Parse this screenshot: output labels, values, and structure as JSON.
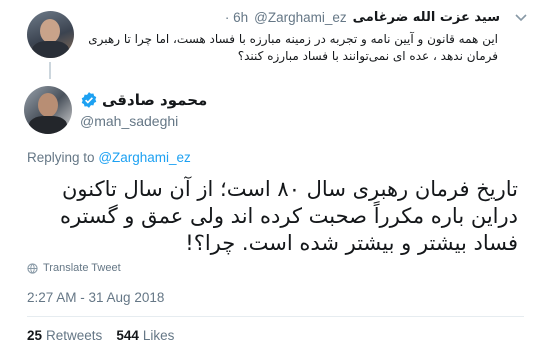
{
  "parent_tweet": {
    "name": "سید عزت الله ضرغامی",
    "handle": "@Zarghami_ez",
    "time": "· 6h",
    "text": "این همه قانون و آیین نامه و تجربه در زمینه مبارزه با فساد هست، اما چرا تا رهبری فرمان ندهد ، عده ای نمی‌توانند با فساد مبارزه کنند؟"
  },
  "tweet": {
    "author_name": "محمود صادقی",
    "author_handle": "@mah_sadeghi",
    "replying_prefix": "Replying to",
    "replying_to": "@Zarghami_ez",
    "text": "تاریخ فرمان رهبری سال ۸۰ است؛ از آن سال تاکنون دراین باره مکرراً صحبت کرده اند ولی عمق و گستره فساد بیشتر و بیشتر شده است. چرا؟!",
    "translate_label": "Translate Tweet",
    "timestamp": "2:27 AM - 31 Aug 2018",
    "retweets_count": "25",
    "retweets_label": "Retweets",
    "likes_count": "544",
    "likes_label": "Likes"
  },
  "colors": {
    "accent": "#1da1f2",
    "secondary_text": "#657786",
    "primary_text": "#14171a"
  },
  "icons": [
    "chevron-down-icon",
    "verified-icon",
    "globe-icon"
  ]
}
